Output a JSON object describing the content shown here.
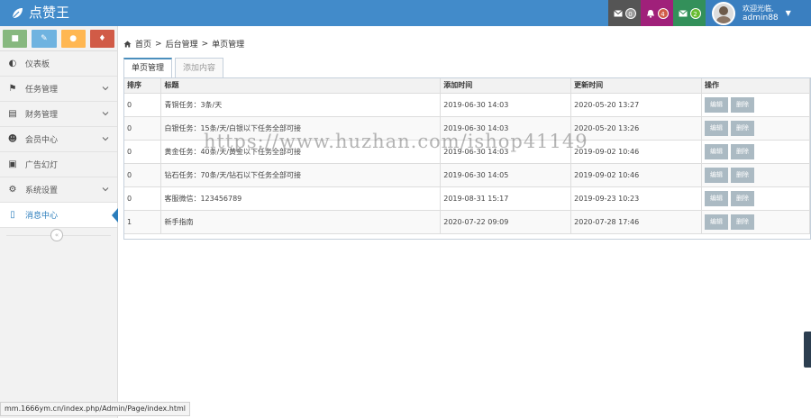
{
  "header": {
    "brand": "点赞王",
    "badges": {
      "mail1": "0",
      "bell": "4",
      "mail2": "2"
    },
    "user": {
      "greeting": "欢迎光临,",
      "name": "admin88"
    }
  },
  "sidebar": {
    "shortcut_icons": [
      "chart-icon",
      "pencil-icon",
      "users-icon",
      "bell-icon"
    ],
    "items": [
      {
        "label": "仪表板",
        "icon": "dashboard-icon",
        "has_children": false
      },
      {
        "label": "任务管理",
        "icon": "flag-icon",
        "has_children": true
      },
      {
        "label": "财务管理",
        "icon": "wallet-icon",
        "has_children": true
      },
      {
        "label": "会员中心",
        "icon": "user-icon",
        "has_children": true
      },
      {
        "label": "广告幻灯",
        "icon": "picture-icon",
        "has_children": false
      },
      {
        "label": "系统设置",
        "icon": "gear-icon",
        "has_children": true
      },
      {
        "label": "消息中心",
        "icon": "bookmark-icon",
        "has_children": false,
        "active": true
      }
    ]
  },
  "breadcrumb": {
    "home": "首页",
    "level1": "后台管理",
    "level2": "单页管理"
  },
  "tabs": [
    {
      "label": "单页管理",
      "active": true
    },
    {
      "label": "添加内容",
      "active": false
    }
  ],
  "table": {
    "headers": [
      "排序",
      "标题",
      "添加时间",
      "更新时间",
      "操作"
    ],
    "edit_label": "编辑",
    "delete_label": "删除",
    "rows": [
      {
        "order": "0",
        "title": "青铜任务：3条/天",
        "added": "2019-06-30 14:03",
        "updated": "2020-05-20 13:27"
      },
      {
        "order": "0",
        "title": "白银任务：15条/天/白银以下任务全部可接",
        "added": "2019-06-30 14:03",
        "updated": "2020-05-20 13:26"
      },
      {
        "order": "0",
        "title": "黄金任务：40条/天/黄金以下任务全部可接",
        "added": "2019-06-30 14:03",
        "updated": "2019-09-02 10:46"
      },
      {
        "order": "0",
        "title": "钻石任务：70条/天/钻石以下任务全部可接",
        "added": "2019-06-30 14:05",
        "updated": "2019-09-02 10:46"
      },
      {
        "order": "0",
        "title": "客服微信：123456789",
        "added": "2019-08-31 15:17",
        "updated": "2019-09-23 10:23"
      },
      {
        "order": "1",
        "title": "新手指南",
        "added": "2020-07-22 09:09",
        "updated": "2020-07-28 17:46"
      }
    ]
  },
  "watermark": "https://www.huzhan.com/ishop41149",
  "statusbar": {
    "url": "mm.1666ym.cn/index.php/Admin/Page/index.html"
  },
  "colors": {
    "header": "#428bca",
    "active_accent": "#2b7dbc",
    "action_button": "#abbac3"
  }
}
